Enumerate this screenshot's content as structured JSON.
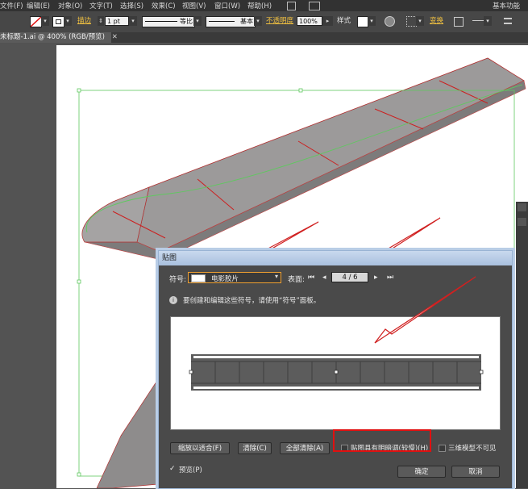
{
  "menubar": {
    "items": [
      "文件(F)",
      "编辑(E)",
      "对象(O)",
      "文字(T)",
      "选择(S)",
      "效果(C)",
      "视图(V)",
      "窗口(W)",
      "帮助(H)"
    ],
    "workspace": "基本功能"
  },
  "controlbar": {
    "stroke_label": "描边",
    "stroke_weight": "1 pt",
    "profile_label": "等比",
    "brush_label": "基本",
    "opacity_label": "不透明度",
    "opacity_value": "100%",
    "style_label": "样式",
    "transform_label": "变换"
  },
  "document": {
    "tab_title": "未标题-1.ai @ 400% (RGB/预览)"
  },
  "dialog": {
    "title": "贴图",
    "symbol_label": "符号:",
    "symbol_value": "电影胶片",
    "surface_label": "表面:",
    "surface_value": "4 / 6",
    "info_text": "要创建和编辑这些符号，请使用“符号”面板。",
    "buttons": {
      "scale_to_fit": "缩放以适合(F)",
      "clear": "清除(C)",
      "clear_all": "全部清除(A)",
      "ok": "确定",
      "cancel": "取消"
    },
    "options": {
      "shade_artwork": "贴图具有明暗调(较慢)(H)",
      "shade_artwork_checked": false,
      "invisible_geometry": "三维模型不可见",
      "invisible_geometry_checked": false,
      "preview": "预览(P)",
      "preview_checked": true
    }
  },
  "colors": {
    "annotation_red": "#e01010",
    "selection_green": "#5fc85f"
  }
}
